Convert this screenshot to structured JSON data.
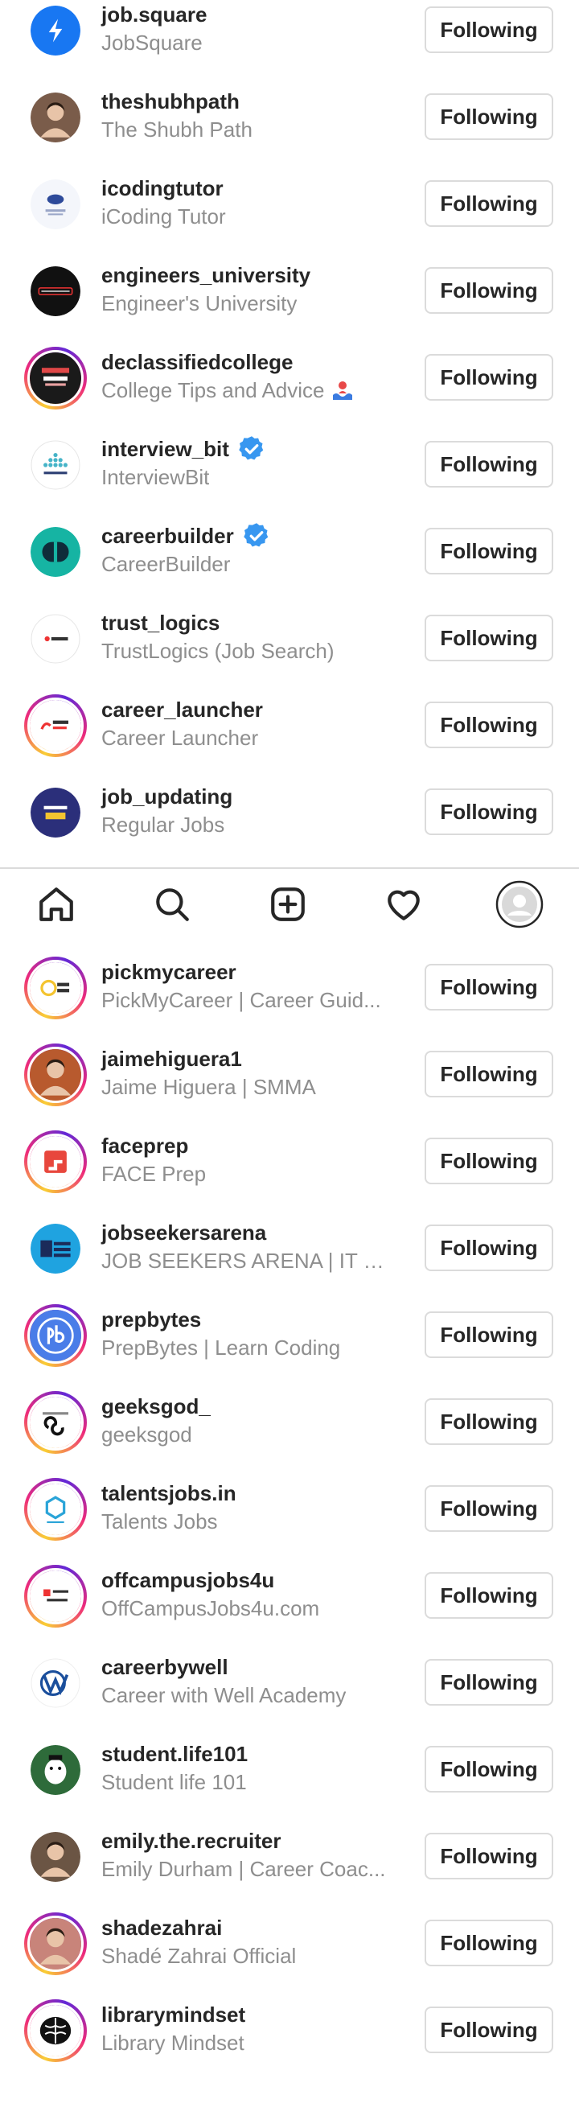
{
  "follow_label": "Following",
  "accounts_top": [
    {
      "username": "job.square",
      "fullname": "JobSquare",
      "verified": false,
      "ring": false,
      "avatar": "jobsquare-logo",
      "color": "#1877f2"
    },
    {
      "username": "theshubhpath",
      "fullname": "The Shubh Path",
      "verified": false,
      "ring": false,
      "avatar": "person-photo",
      "color": "#7a5c4a"
    },
    {
      "username": "icodingtutor",
      "fullname": "iCoding Tutor",
      "verified": false,
      "ring": false,
      "avatar": "icoding-logo",
      "color": "#2d4a9a"
    },
    {
      "username": "engineers_university",
      "fullname": "Engineer's University",
      "verified": false,
      "ring": false,
      "avatar": "engineers-logo",
      "color": "#111111"
    },
    {
      "username": "declassifiedcollege",
      "fullname": "College Tips and Advice",
      "verified": false,
      "ring": true,
      "avatar": "college-logo",
      "color": "#1a1a1a"
    },
    {
      "username": "interview_bit",
      "fullname": "InterviewBit",
      "verified": true,
      "ring": false,
      "avatar": "interviewbit-logo",
      "color": "#ffffff"
    },
    {
      "username": "careerbuilder",
      "fullname": "CareerBuilder",
      "verified": true,
      "ring": false,
      "avatar": "careerbuilder-logo",
      "color": "#16b4a3"
    },
    {
      "username": "trust_logics",
      "fullname": "TrustLogics (Job Search)",
      "verified": false,
      "ring": false,
      "avatar": "trustlogics-logo",
      "color": "#ffffff"
    },
    {
      "username": "career_launcher",
      "fullname": "Career Launcher",
      "verified": false,
      "ring": true,
      "avatar": "careerlauncher-logo",
      "color": "#ffffff"
    },
    {
      "username": "job_updating",
      "fullname": "Regular Jobs",
      "verified": false,
      "ring": false,
      "avatar": "regularjobs-logo",
      "color": "#2b2f7a"
    }
  ],
  "tabbar": {
    "items": [
      {
        "name": "home"
      },
      {
        "name": "search"
      },
      {
        "name": "create"
      },
      {
        "name": "activity"
      },
      {
        "name": "profile"
      }
    ]
  },
  "accounts_bottom": [
    {
      "username": "pickmycareer",
      "fullname": "PickMyCareer | Career Guid...",
      "ring": true,
      "avatar": "pickmycareer-logo",
      "color": "#ffffff"
    },
    {
      "username": "jaimehiguera1",
      "fullname": "Jaime Higuera | SMMA",
      "ring": true,
      "avatar": "person-photo",
      "color": "#b85a2e"
    },
    {
      "username": "faceprep",
      "fullname": "FACE Prep",
      "ring": true,
      "avatar": "faceprep-logo",
      "color": "#ffffff"
    },
    {
      "username": "jobseekersarena",
      "fullname": "JOB SEEKERS ARENA | IT J...",
      "ring": false,
      "avatar": "jsa-logo",
      "color": "#1fa3e0"
    },
    {
      "username": "prepbytes",
      "fullname": "PrepBytes | Learn Coding",
      "ring": true,
      "avatar": "prepbytes-logo",
      "color": "#4a7de8"
    },
    {
      "username": "geeksgod_",
      "fullname": "geeksgod",
      "ring": true,
      "avatar": "geeksgod-logo",
      "color": "#ffffff"
    },
    {
      "username": "talentsjobs.in",
      "fullname": "Talents Jobs",
      "ring": true,
      "avatar": "talents-logo",
      "color": "#ffffff"
    },
    {
      "username": "offcampusjobs4u",
      "fullname": "OffCampusJobs4u.com",
      "ring": true,
      "avatar": "offcampus-logo",
      "color": "#ffffff"
    },
    {
      "username": "careerbywell",
      "fullname": "Career with Well Academy",
      "ring": false,
      "avatar": "well-logo",
      "color": "#ffffff"
    },
    {
      "username": "student.life101",
      "fullname": "Student life 101",
      "ring": false,
      "avatar": "studentlife-logo",
      "color": "#2e6b3a"
    },
    {
      "username": "emily.the.recruiter",
      "fullname": "Emily Durham | Career Coac...",
      "ring": false,
      "avatar": "person-photo",
      "color": "#6b5544"
    },
    {
      "username": "shadezahrai",
      "fullname": "Shadé Zahrai Official",
      "ring": true,
      "avatar": "person-photo",
      "color": "#c8847a"
    },
    {
      "username": "librarymindset",
      "fullname": "Library Mindset",
      "ring": true,
      "avatar": "brain-logo",
      "color": "#ffffff"
    }
  ]
}
